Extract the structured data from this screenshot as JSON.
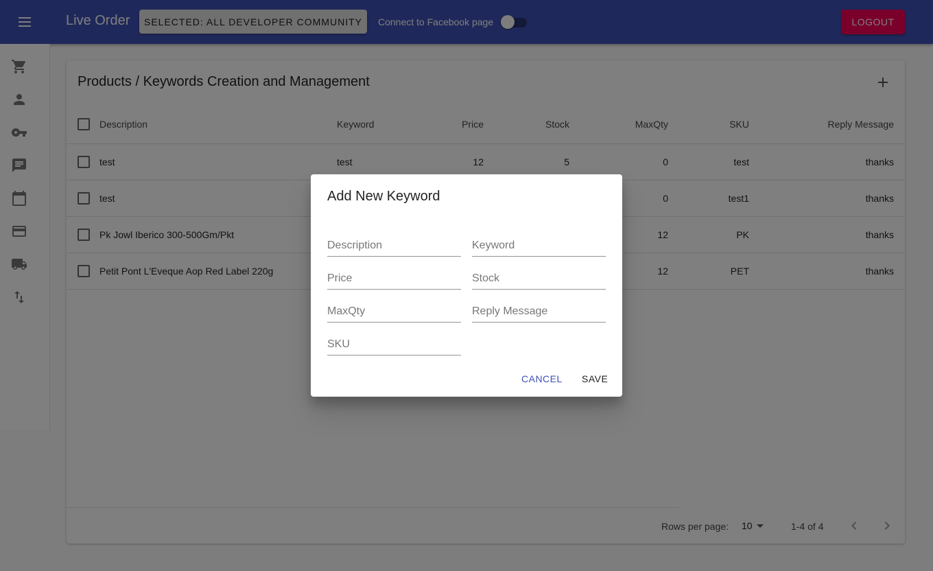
{
  "appbar": {
    "title": "Live Order",
    "community_button": "SELECTED: ALL DEVELOPER COMMUNITY",
    "facebook_label": "Connect to Facebook page",
    "facebook_connected": false,
    "logout_label": "LOGOUT",
    "primary_color": "#3f51b5",
    "accent_color": "#f50057"
  },
  "sidenav": {
    "icons": [
      "cart-icon",
      "person-icon",
      "key-icon",
      "message-icon",
      "calendar-icon",
      "credit-card-icon",
      "truck-icon",
      "swap-vertical-icon"
    ]
  },
  "card": {
    "title": "Products / Keywords Creation and Management",
    "columns": [
      "Description",
      "Keyword",
      "Price",
      "Stock",
      "MaxQty",
      "SKU",
      "Reply Message"
    ],
    "rows": [
      {
        "description": "test",
        "keyword": "test",
        "price": "12",
        "stock": "5",
        "maxqty": "0",
        "sku": "test",
        "reply": "thanks"
      },
      {
        "description": "test",
        "keyword": "",
        "price": "",
        "stock": "",
        "maxqty": "0",
        "sku": "test1",
        "reply": "thanks"
      },
      {
        "description": "Pk Jowl Iberico 300-500Gm/Pkt",
        "keyword": "",
        "price": "",
        "stock": "",
        "maxqty": "12",
        "sku": "PK",
        "reply": "thanks"
      },
      {
        "description": "Petit Pont L'Eveque Aop Red Label 220g",
        "keyword": "",
        "price": "",
        "stock": "",
        "maxqty": "12",
        "sku": "PET",
        "reply": "thanks"
      }
    ],
    "footer": {
      "rows_per_page_label": "Rows per page:",
      "rows_per_page_value": "10",
      "range_label": "1-4 of 4"
    }
  },
  "dialog": {
    "title": "Add New Keyword",
    "fields": {
      "description": {
        "placeholder": "Description",
        "value": ""
      },
      "keyword": {
        "placeholder": "Keyword",
        "value": ""
      },
      "price": {
        "placeholder": "Price",
        "value": ""
      },
      "stock": {
        "placeholder": "Stock",
        "value": ""
      },
      "maxqty": {
        "placeholder": "MaxQty",
        "value": ""
      },
      "reply": {
        "placeholder": "Reply Message",
        "value": ""
      },
      "sku": {
        "placeholder": "SKU",
        "value": ""
      }
    },
    "cancel_label": "CANCEL",
    "save_label": "SAVE"
  }
}
